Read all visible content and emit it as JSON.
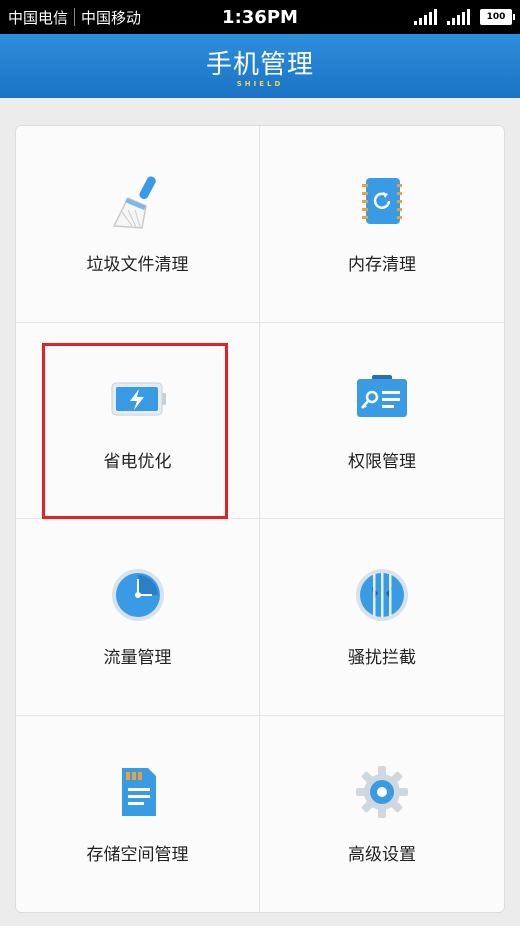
{
  "status_bar": {
    "carrier1": "中国电信",
    "carrier2": "中国移动",
    "time": "1:36PM",
    "battery": "100"
  },
  "header": {
    "title": "手机管理",
    "subtitle": "SHIELD"
  },
  "colors": {
    "header_blue": "#1a73c6",
    "icon_blue": "#3a9be5",
    "highlight_red": "#e52222"
  },
  "grid": {
    "items": [
      {
        "label": "垃圾文件清理",
        "icon": "broom-icon"
      },
      {
        "label": "内存清理",
        "icon": "notebook-refresh-icon"
      },
      {
        "label": "省电优化",
        "icon": "battery-bolt-icon"
      },
      {
        "label": "权限管理",
        "icon": "key-card-icon"
      },
      {
        "label": "流量管理",
        "icon": "clock-dial-icon"
      },
      {
        "label": "骚扰拦截",
        "icon": "shield-face-icon"
      },
      {
        "label": "存储空间管理",
        "icon": "sd-card-icon"
      },
      {
        "label": "高级设置",
        "icon": "gear-icon"
      }
    ]
  }
}
